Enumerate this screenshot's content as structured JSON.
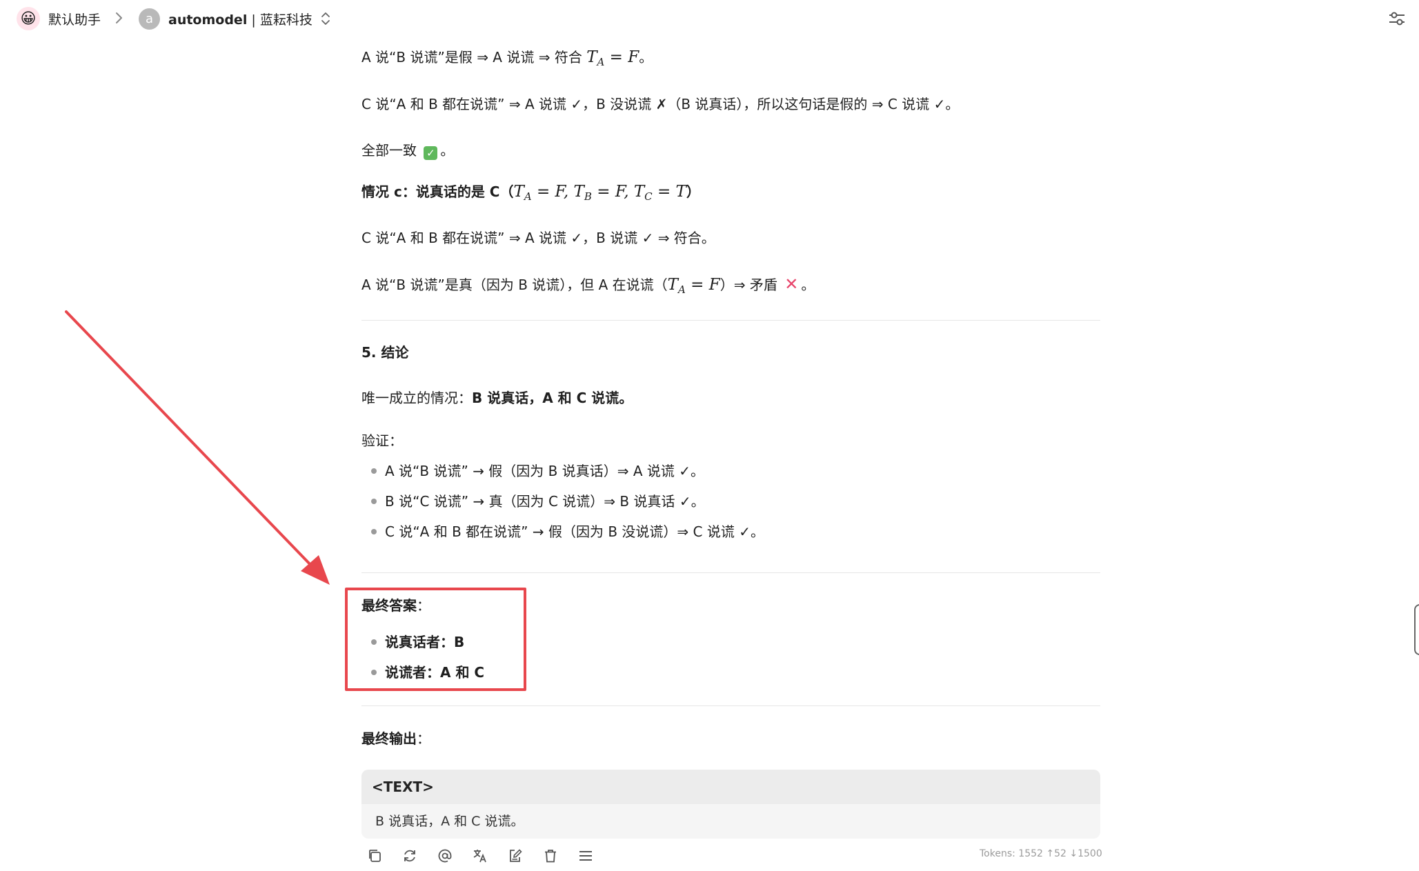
{
  "header": {
    "assistant_name": "默认助手",
    "model_initial": "a",
    "model_name": "automodel",
    "model_provider": " | 蓝耘科技"
  },
  "message": {
    "l1": "A 说“B 说谎”是假 ⇒ A 说谎 ⇒ 符合 ",
    "l1_math": "T",
    "l1_sub": "A",
    "l1_math2": " = F",
    "l1_end": "。",
    "l2": "C 说“A 和 B 都在说谎” ⇒ A 说谎 ✓，B 没说谎 ✗（B 说真话），所以这句话是假的 ⇒ C 说谎 ✓。",
    "l3": "全部一致 ",
    "l3_end": "。",
    "case_c_label": "情况 c：说真话的是 C（",
    "case_c_math": "T",
    "case_c_sub_a": "A",
    "case_c_math_a": " = F, T",
    "case_c_sub_b": "B",
    "case_c_math_b": " = F, T",
    "case_c_sub_c": "C",
    "case_c_math_c": " = T",
    "case_c_end": "）",
    "l5": "C 说“A 和 B 都在说谎” ⇒ A 说谎 ✓，B 说谎 ✓ ⇒ 符合。",
    "l6": "A 说“B 说谎”是真（因为 B 说谎），但 A 在说谎（",
    "l6_math": "T",
    "l6_sub": "A",
    "l6_math2": " = F",
    "l6_end": "）⇒ 矛盾 ",
    "l6_tail": "。",
    "section5": "5. 结论",
    "only_case_prefix": "唯一成立的情况：",
    "only_case_bold": "B 说真话，A 和 C 说谎。",
    "verify_label": "验证：",
    "verify_items": [
      "A 说“B 说谎” → 假（因为 B 说真话）⇒ A 说谎 ✓。",
      "B 说“C 说谎” → 真（因为 C 说谎）⇒ B 说真话 ✓。",
      "C 说“A 和 B 都在说谎” → 假（因为 B 没说谎）⇒ C 说谎 ✓。"
    ],
    "final_answer_label": "最终答案",
    "final_answer_colon": "：",
    "final_answer_items": [
      "说真话者：B",
      "说谎者：A 和 C"
    ],
    "final_output_label": "最终输出",
    "final_output_colon": "：",
    "code_lang": "<TEXT>",
    "code_text": "B 说真话，A 和 C 说谎。",
    "tokens": "Tokens: 1552 ↑52 ↓1500"
  },
  "colors": {
    "highlight": "#e8474d",
    "arrow": "#e8474d"
  },
  "icons": [
    "chevron-right-icon",
    "chevron-updown-icon",
    "settings-sliders-icon",
    "copy-icon",
    "refresh-icon",
    "mention-icon",
    "translate-icon",
    "edit-icon",
    "delete-icon",
    "menu-icon"
  ]
}
